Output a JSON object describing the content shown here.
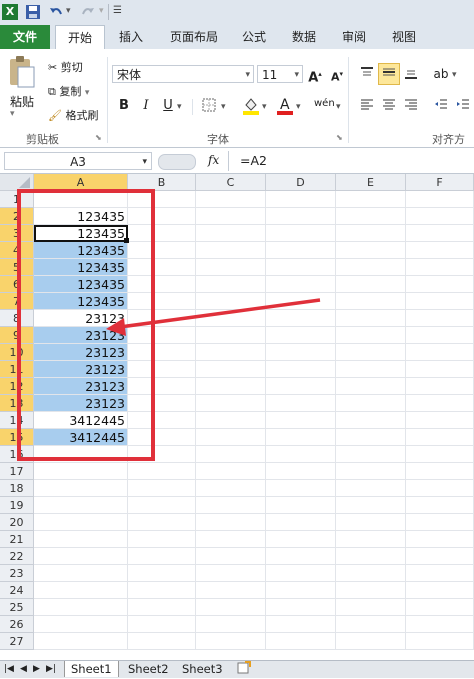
{
  "app": {
    "logo": "X"
  },
  "ribbon_tabs": [
    "文件",
    "开始",
    "插入",
    "页面布局",
    "公式",
    "数据",
    "审阅",
    "视图"
  ],
  "clipboard": {
    "paste": "粘贴",
    "cut": "剪切",
    "copy": "复制",
    "format_painter": "格式刷",
    "group": "剪贴板"
  },
  "font": {
    "name": "宋体",
    "size": "11",
    "group": "字体",
    "bold": "B",
    "italic": "I",
    "underline": "U",
    "phonetic": "wén"
  },
  "alignment": {
    "group": "对齐方式"
  },
  "formula_bar": {
    "name_box": "A3",
    "fx": "fx",
    "formula": "=A2"
  },
  "columns": [
    "A",
    "B",
    "C",
    "D",
    "E",
    "F"
  ],
  "rows": [
    {
      "n": "1",
      "a": "",
      "hl": false
    },
    {
      "n": "2",
      "a": "123435",
      "hl": false
    },
    {
      "n": "3",
      "a": "123435",
      "hl": false
    },
    {
      "n": "4",
      "a": "123435",
      "hl": true
    },
    {
      "n": "5",
      "a": "123435",
      "hl": true
    },
    {
      "n": "6",
      "a": "123435",
      "hl": true
    },
    {
      "n": "7",
      "a": "123435",
      "hl": true
    },
    {
      "n": "8",
      "a": "23123",
      "hl": false
    },
    {
      "n": "9",
      "a": "23123",
      "hl": true
    },
    {
      "n": "10",
      "a": "23123",
      "hl": true
    },
    {
      "n": "11",
      "a": "23123",
      "hl": true
    },
    {
      "n": "12",
      "a": "23123",
      "hl": true
    },
    {
      "n": "13",
      "a": "23123",
      "hl": true
    },
    {
      "n": "14",
      "a": "3412445",
      "hl": false
    },
    {
      "n": "15",
      "a": "3412445",
      "hl": true
    },
    {
      "n": "16",
      "a": "",
      "hl": false
    },
    {
      "n": "17",
      "a": "",
      "hl": false
    },
    {
      "n": "18",
      "a": "",
      "hl": false
    },
    {
      "n": "19",
      "a": "",
      "hl": false
    },
    {
      "n": "20",
      "a": "",
      "hl": false
    },
    {
      "n": "21",
      "a": "",
      "hl": false
    },
    {
      "n": "22",
      "a": "",
      "hl": false
    },
    {
      "n": "23",
      "a": "",
      "hl": false
    },
    {
      "n": "24",
      "a": "",
      "hl": false
    },
    {
      "n": "25",
      "a": "",
      "hl": false
    },
    {
      "n": "26",
      "a": "",
      "hl": false
    },
    {
      "n": "27",
      "a": "",
      "hl": false
    }
  ],
  "selected_rows": [
    "2",
    "3",
    "4",
    "5",
    "6",
    "7",
    "9",
    "10",
    "11",
    "12",
    "13",
    "15"
  ],
  "sheets": [
    "Sheet1",
    "Sheet2",
    "Sheet3"
  ],
  "colors": {
    "file_tab": "#2a8a3a",
    "highlight": "#a8cdee",
    "row_selected": "#f9d36b",
    "annotation": "#e0303a"
  }
}
